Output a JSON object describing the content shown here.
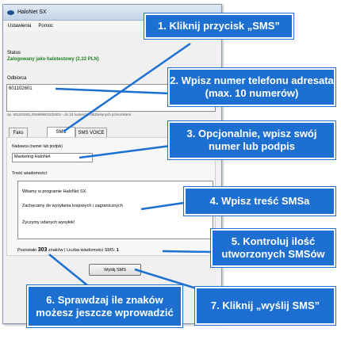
{
  "window": {
    "title": "HaloNet SX",
    "menu": [
      "Ustawienia",
      "Pomoc"
    ],
    "status_label": "Status",
    "status_value": "Zalogowany jako halotestowy (2.32 PLN)",
    "recipient_label": "Odbiorca",
    "recipient_value": "601102601",
    "recipient_hint": "np. 601102601,004869601102601 - do 10 numerów oddzielonych przecinkami",
    "tabs": [
      "Faks",
      "SMS",
      "SMS VOICE"
    ],
    "sender_label": "Nadawca (numer lub podpis)",
    "sender_value": "Marketing HaloNet",
    "message_label": "Treść wiadomości",
    "message_lines": [
      "Witamy w programie HaloNet SX.",
      "Zachęcamy do wysyłania krajowych i zagranicznych",
      "Życzymy udanych wysyłek!"
    ],
    "remaining_label": "Pozostało",
    "remaining_count": "303",
    "remaining_unit": "znaków",
    "sms_count_label": "Liczba wiadomości SMS:",
    "sms_count": "1",
    "send_button": "Wyślij SMS"
  },
  "callouts": [
    "1. Kliknij przycisk „SMS”",
    "2. Wpisz numer telefonu adresata (max. 10 numerów)",
    "3. Opcjonalnie, wpisz swój numer lub podpis",
    "4. Wpisz treść SMSa",
    "5. Kontroluj ilość utworzonych SMSów",
    "6. Sprawdzaj ile znaków możesz jeszcze wprowadzić",
    "7. Kliknij „wyślij SMS”"
  ],
  "colors": {
    "callout": "#1d6fd1",
    "status_ok": "#1d7f1d"
  }
}
